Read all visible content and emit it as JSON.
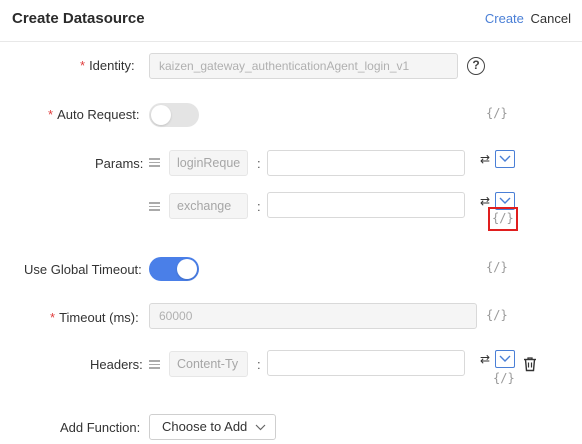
{
  "header": {
    "title": "Create Datasource",
    "create_label": "Create",
    "cancel_label": "Cancel"
  },
  "form": {
    "identity": {
      "label": "Identity",
      "value": "kaizen_gateway_authenticationAgent_login_v1",
      "help": "?"
    },
    "auto_request": {
      "label": "Auto Request",
      "enabled": false,
      "code_toggle": "{/}"
    },
    "params": {
      "label": "Params",
      "rows": [
        {
          "key": "loginReque",
          "value": "",
          "swap": "⇄",
          "code_toggle": "{/}"
        },
        {
          "key": "exchange",
          "value": "",
          "swap": "⇄",
          "code_toggle": "{/}"
        }
      ]
    },
    "use_global_timeout": {
      "label": "Use Global Timeout",
      "enabled": true,
      "code_toggle": "{/}"
    },
    "timeout": {
      "label": "Timeout (ms)",
      "value": "60000",
      "code_toggle": "{/}"
    },
    "headers": {
      "label": "Headers",
      "rows": [
        {
          "key": "Content-Ty",
          "value": "",
          "swap": "⇄",
          "code_toggle": "{/}"
        }
      ]
    },
    "add_function": {
      "label": "Add Function",
      "select_value": "Choose to Add"
    }
  },
  "colors": {
    "accent": "#4a7fd6",
    "required": "#e03c3c",
    "highlight": "#e01e1e",
    "toggle_on": "#4a7fe8"
  }
}
